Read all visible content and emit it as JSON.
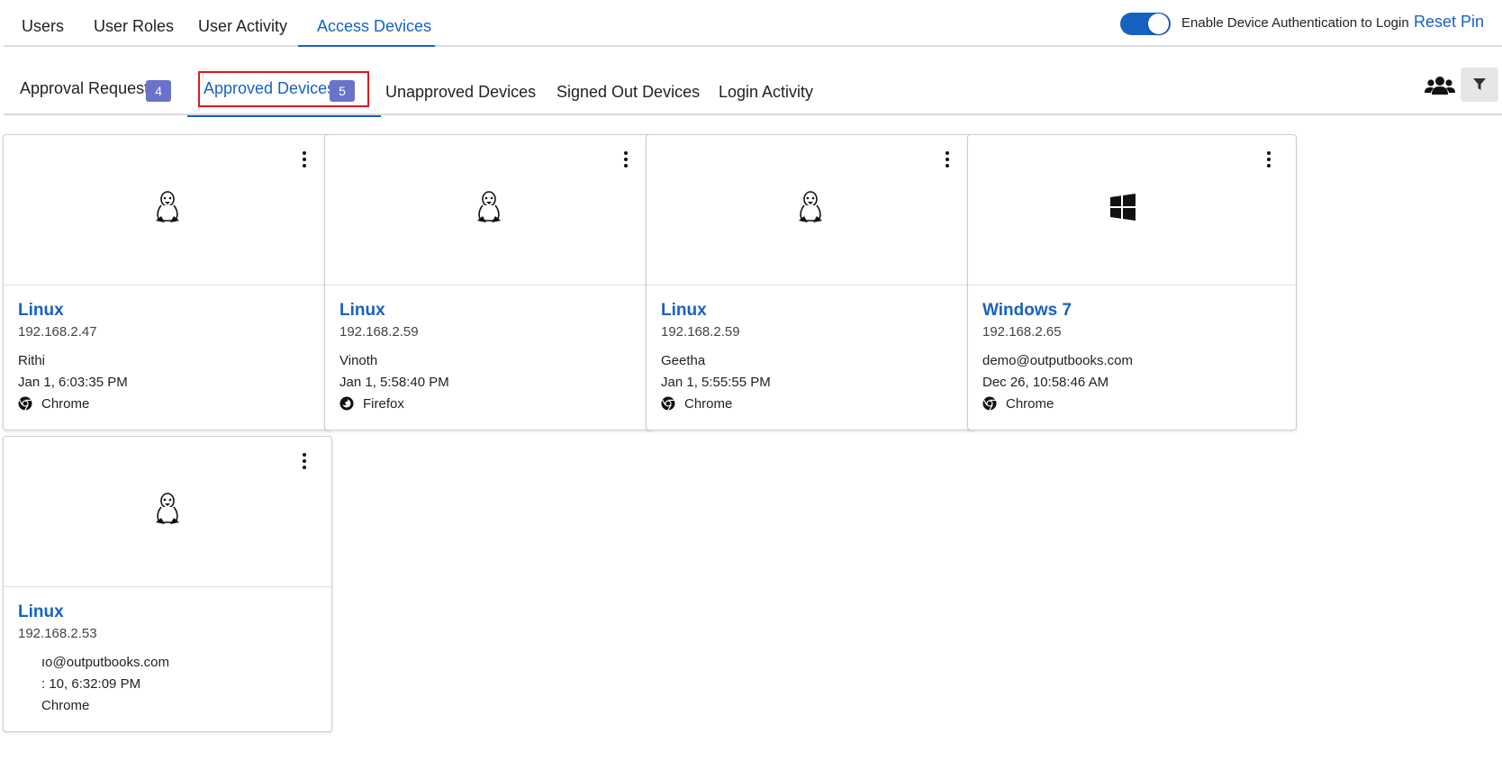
{
  "top_tabs": [
    {
      "label": "Users"
    },
    {
      "label": "User Roles"
    },
    {
      "label": "User Activity"
    },
    {
      "label": "Access Devices",
      "active": true
    }
  ],
  "toggle": {
    "label": "Enable Device Authentication to Login",
    "on": true
  },
  "reset_pin_label": "Reset Pin",
  "sub_tabs": [
    {
      "label": "Approval Requests",
      "badge": "4"
    },
    {
      "label": "Approved Devices",
      "badge": "5",
      "active": true
    },
    {
      "label": "Unapproved Devices"
    },
    {
      "label": "Signed Out Devices"
    },
    {
      "label": "Login Activity"
    }
  ],
  "icons": {
    "group": "users-group-icon",
    "filter": "filter-icon",
    "menu": "more-vertical-icon",
    "linux": "linux-tux-icon",
    "windows": "windows-logo-icon",
    "chrome": "chrome-icon",
    "firefox": "firefox-icon"
  },
  "colors": {
    "accent": "#1762bf",
    "badge": "#6a72c9",
    "highlight": "#e0161e"
  },
  "devices": [
    {
      "os": "Linux",
      "ip": "192.168.2.47",
      "user": "Rithi",
      "time": "Jan 1, 6:03:35 PM",
      "browser": "Chrome"
    },
    {
      "os": "Linux",
      "ip": "192.168.2.59",
      "user": "Vinoth",
      "time": "Jan 1, 5:58:40 PM",
      "browser": "Firefox"
    },
    {
      "os": "Linux",
      "ip": "192.168.2.59",
      "user": "Geetha",
      "time": "Jan 1, 5:55:55 PM",
      "browser": "Chrome"
    },
    {
      "os": "Windows 7",
      "ip": "192.168.2.65",
      "user": "demo@outputbooks.com",
      "time": "Dec 26, 10:58:46 AM",
      "browser": "Chrome"
    },
    {
      "os": "Linux",
      "ip": "192.168.2.53",
      "user": "ıo@outputbooks.com",
      "time": ": 10, 6:32:09 PM",
      "browser": "Chrome"
    }
  ]
}
